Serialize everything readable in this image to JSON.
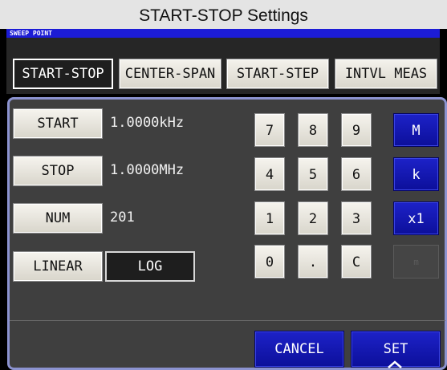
{
  "window": {
    "title": "START-STOP Settings"
  },
  "sweep_point_label": "SWEEP POINT",
  "tabs": [
    {
      "label": "START-STOP",
      "active": true
    },
    {
      "label": "CENTER-SPAN",
      "active": false
    },
    {
      "label": "START-STEP",
      "active": false
    },
    {
      "label": "INTVL MEAS",
      "active": false
    }
  ],
  "params": {
    "start": {
      "label": "START",
      "value": "1.0000kHz"
    },
    "stop": {
      "label": "STOP",
      "value": "1.0000MHz"
    },
    "num": {
      "label": "NUM",
      "value": "201"
    }
  },
  "scale": {
    "linear_label": "LINEAR",
    "log_label": "LOG",
    "selected": "LOG"
  },
  "keypad": {
    "keys": [
      "7",
      "8",
      "9",
      "4",
      "5",
      "6",
      "1",
      "2",
      "3",
      "0",
      ".",
      "C"
    ],
    "units": [
      "M",
      "k",
      "x1",
      "m"
    ]
  },
  "footer": {
    "cancel_label": "CANCEL",
    "set_label": "SET"
  },
  "colors": {
    "panel_border": "#8c93d0",
    "unit_key": "#1d22c8",
    "sweep_bar": "#1c1cd6"
  }
}
